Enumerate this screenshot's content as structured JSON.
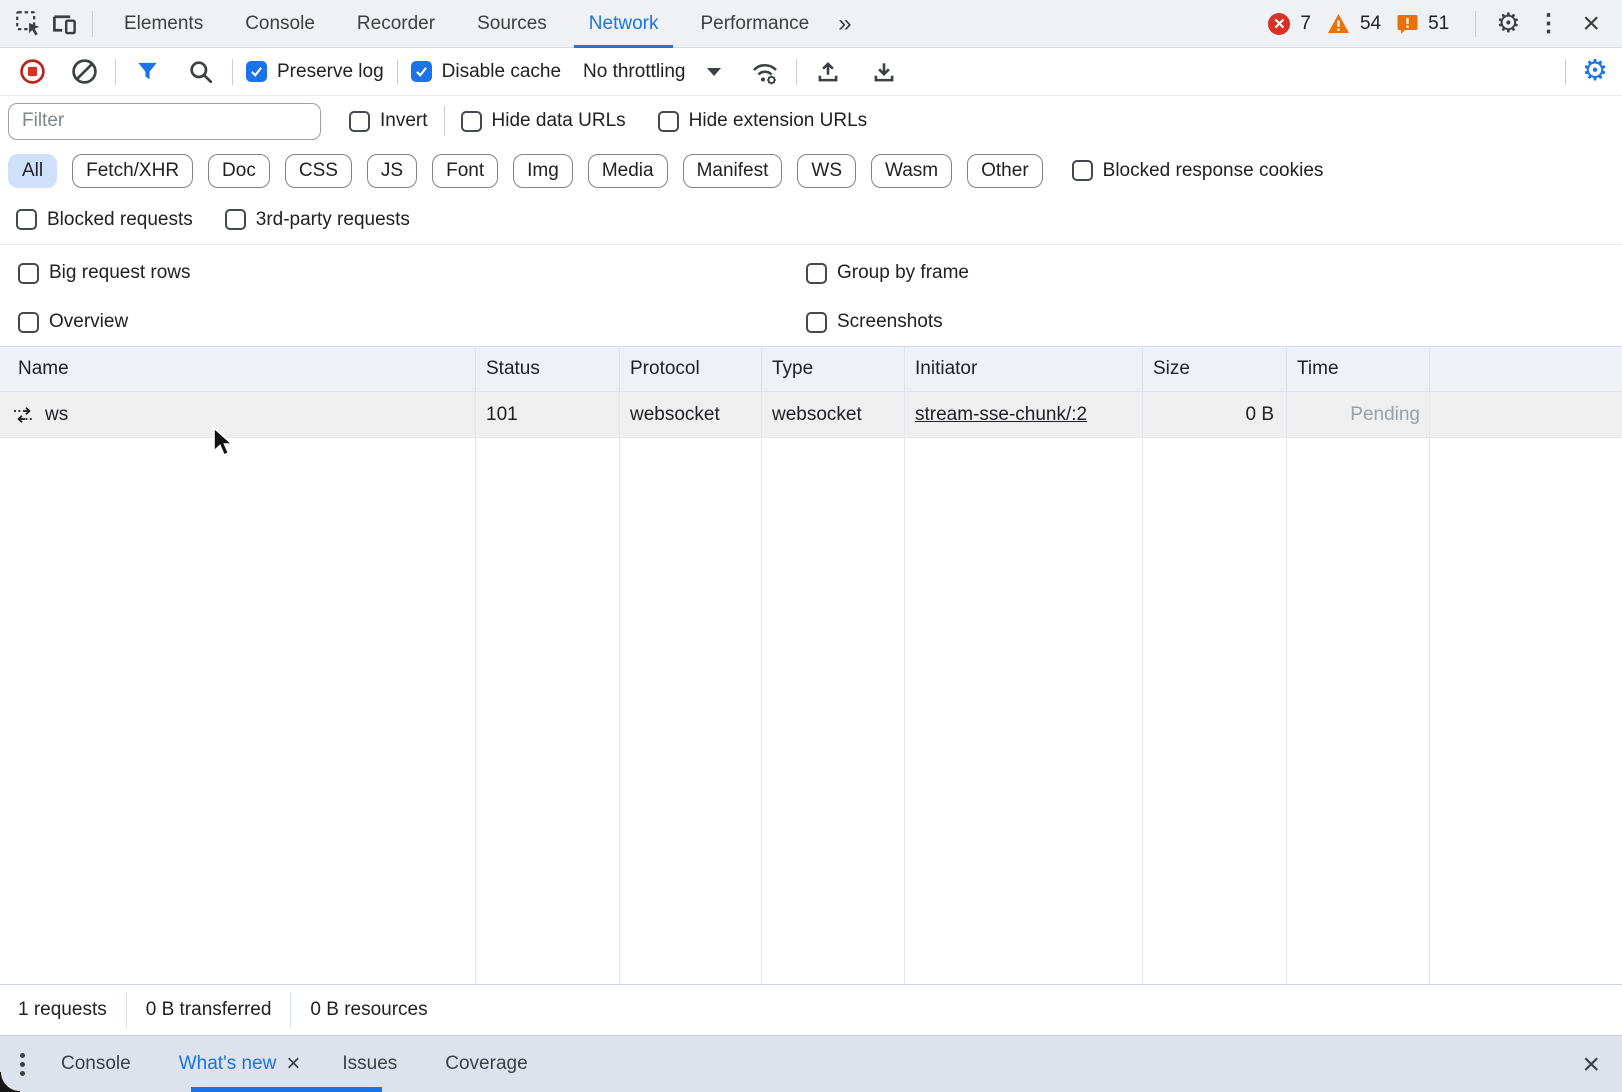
{
  "colors": {
    "accent": "#1a73e8",
    "error": "#d93025",
    "warning": "#e8710a",
    "pending_gray": "#9aa0a6",
    "selected_chip_bg": "#cfe0fb"
  },
  "top_bar": {
    "tabs": [
      {
        "label": "Elements"
      },
      {
        "label": "Console"
      },
      {
        "label": "Recorder"
      },
      {
        "label": "Sources"
      },
      {
        "label": "Network"
      },
      {
        "label": "Performance"
      }
    ],
    "more_tabs_glyph": "»",
    "badges": {
      "errors": "7",
      "warnings": "54",
      "issues": "51"
    }
  },
  "network_toolbar": {
    "preserve_log_label": "Preserve log",
    "disable_cache_label": "Disable cache",
    "throttling_value": "No throttling"
  },
  "filter_bar": {
    "placeholder": "Filter",
    "invert_label": "Invert",
    "hide_data_urls_label": "Hide data URLs",
    "hide_extension_urls_label": "Hide extension URLs"
  },
  "type_chips": [
    "All",
    "Fetch/XHR",
    "Doc",
    "CSS",
    "JS",
    "Font",
    "Img",
    "Media",
    "Manifest",
    "WS",
    "Wasm",
    "Other"
  ],
  "blocked_response_cookies_label": "Blocked response cookies",
  "request_filters": {
    "blocked_requests_label": "Blocked requests",
    "third_party_label": "3rd-party requests"
  },
  "options": {
    "big_request_rows": "Big request rows",
    "group_by_frame": "Group by frame",
    "overview": "Overview",
    "screenshots": "Screenshots"
  },
  "table": {
    "columns": [
      "Name",
      "Status",
      "Protocol",
      "Type",
      "Initiator",
      "Size",
      "Time"
    ],
    "rows": [
      {
        "name": "ws",
        "status": "101",
        "protocol": "websocket",
        "type": "websocket",
        "initiator": "stream-sse-chunk/:2",
        "size": "0 B",
        "time": "Pending"
      }
    ]
  },
  "summary": {
    "requests": "1 requests",
    "transferred": "0 B transferred",
    "resources": "0 B resources"
  },
  "drawer": {
    "tabs": [
      {
        "label": "Console"
      },
      {
        "label": "What's new"
      },
      {
        "label": "Issues"
      },
      {
        "label": "Coverage"
      }
    ]
  }
}
